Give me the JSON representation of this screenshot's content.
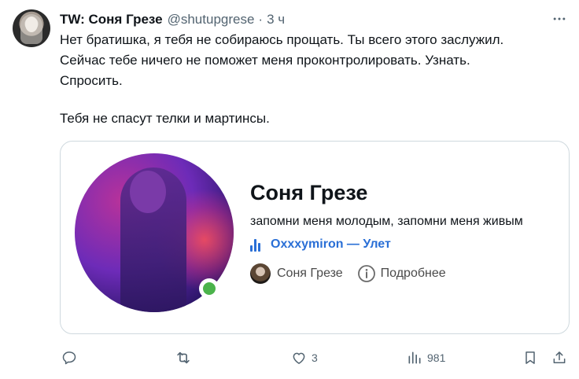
{
  "tweet": {
    "author_name": "TW: Соня Грезе",
    "handle": "@shutupgrese",
    "separator": "·",
    "time": "3 ч",
    "text_lines": [
      "Нет братишка, я тебя не собираюсь прощать. Ты всего этого заслужил.",
      "Сейчас тебе ничего не поможет меня проконтролировать. Узнать.",
      "Спросить."
    ],
    "text_last": "Тебя не спасут телки и мартинсы."
  },
  "card": {
    "name": "Соня Грезе",
    "status": "запомни меня молодым, запомни меня живым",
    "music": "Oxxxymiron — Улет",
    "chip_name": "Соня Грезе",
    "chip_more": "Подробнее"
  },
  "actions": {
    "reply": "",
    "retweet": "",
    "likes": "3",
    "views": "981"
  },
  "icons": {
    "more": "more-horizontal-icon",
    "reply": "reply-icon",
    "retweet": "retweet-icon",
    "like": "heart-icon",
    "views": "views-icon",
    "bookmark": "bookmark-icon",
    "share": "share-icon",
    "music": "music-equalizer-icon",
    "info": "info-icon"
  },
  "colors": {
    "text": "#0f1419",
    "secondary": "#536471",
    "link": "#2a6fd6",
    "online": "#4bb34b",
    "border": "#cfd9de"
  }
}
